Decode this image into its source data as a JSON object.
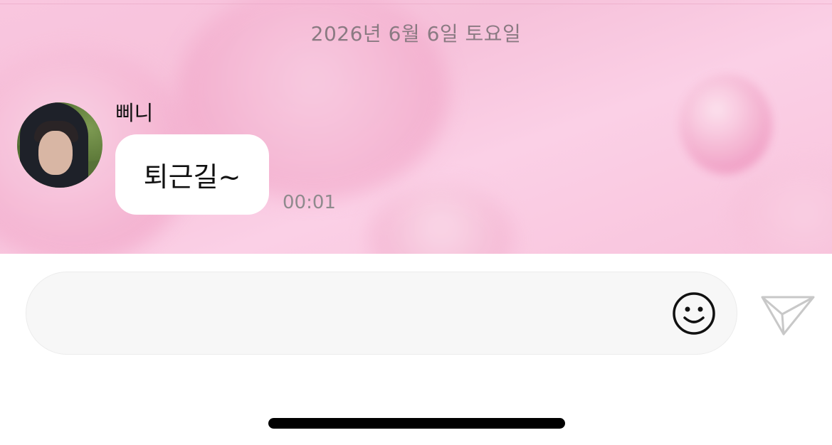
{
  "chat": {
    "date_separator": "2026년 6월 6일 토요일",
    "messages": [
      {
        "sender": "삐니",
        "text": "퇴근길~",
        "time": "00:01"
      }
    ]
  },
  "composer": {
    "placeholder": "",
    "emoji_icon": "smiley-icon",
    "send_icon": "paper-plane-icon"
  },
  "colors": {
    "background_pink": "#f8c3dc",
    "bubble": "#ffffff",
    "input_bg": "#f7f7f7"
  }
}
